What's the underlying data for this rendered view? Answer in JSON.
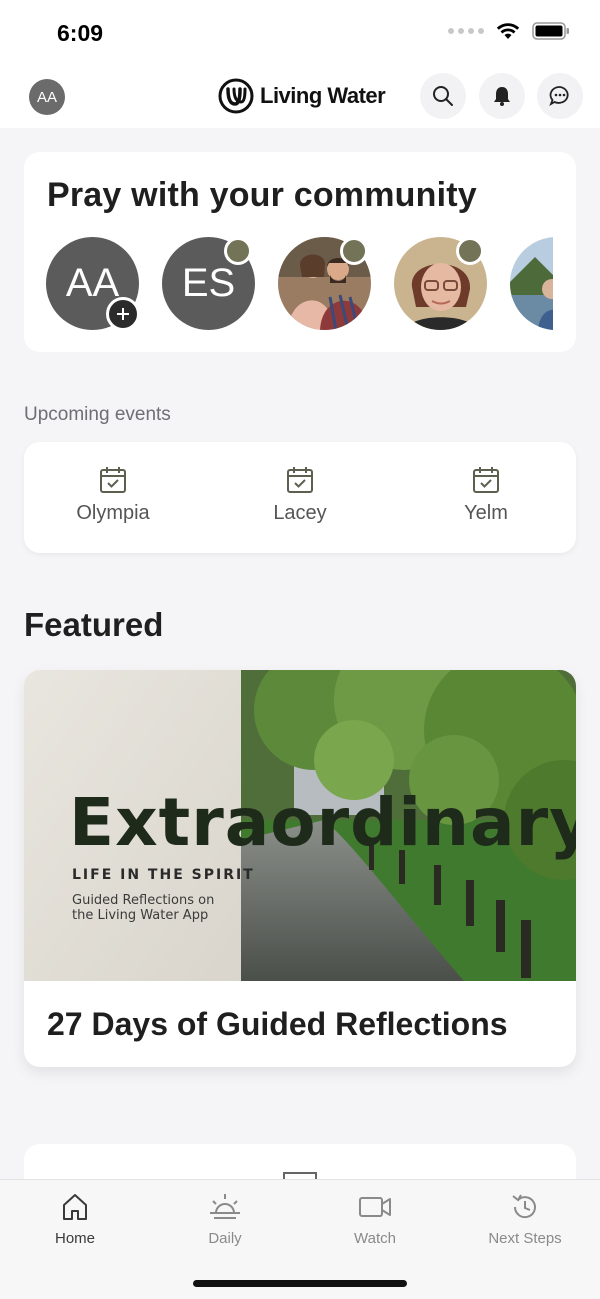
{
  "status_bar": {
    "time": "6:09"
  },
  "header": {
    "avatar_initials": "AA",
    "brand_name": "Living Water",
    "icons": [
      "search-icon",
      "bell-icon",
      "chat-icon"
    ]
  },
  "community": {
    "title": "Pray with your community",
    "people": [
      {
        "initials": "AA",
        "badge": "add"
      },
      {
        "initials": "ES",
        "badge": "online"
      },
      {
        "initials": "",
        "badge": "online",
        "photo": "couple"
      },
      {
        "initials": "",
        "badge": "online",
        "photo": "woman"
      },
      {
        "initials": "",
        "badge": "",
        "photo": "landscape"
      }
    ]
  },
  "events": {
    "label": "Upcoming events",
    "items": [
      {
        "label": "Olympia",
        "icon": "calendar-check-icon"
      },
      {
        "label": "Lacey",
        "icon": "calendar-check-icon"
      },
      {
        "label": "Yelm",
        "icon": "calendar-check-icon"
      }
    ]
  },
  "featured": {
    "heading": "Featured",
    "image_title": "Extraordinary",
    "image_subtitle": "LIFE IN THE SPIRIT",
    "image_tagline_1": "Guided Reflections on",
    "image_tagline_2": "the Living Water App",
    "caption": "27 Days of Guided Reflections"
  },
  "tab_bar": {
    "tabs": [
      {
        "label": "Home",
        "icon": "home-icon",
        "active": true
      },
      {
        "label": "Daily",
        "icon": "sunrise-icon",
        "active": false
      },
      {
        "label": "Watch",
        "icon": "video-icon",
        "active": false
      },
      {
        "label": "Next Steps",
        "icon": "history-icon",
        "active": false
      }
    ]
  },
  "colors": {
    "background": "#f5f5f7",
    "card": "#ffffff",
    "avatar_gray": "#5b5b5b",
    "online_dot": "#737358",
    "text_primary": "#1f1f1f",
    "text_secondary": "#6e6e73"
  }
}
